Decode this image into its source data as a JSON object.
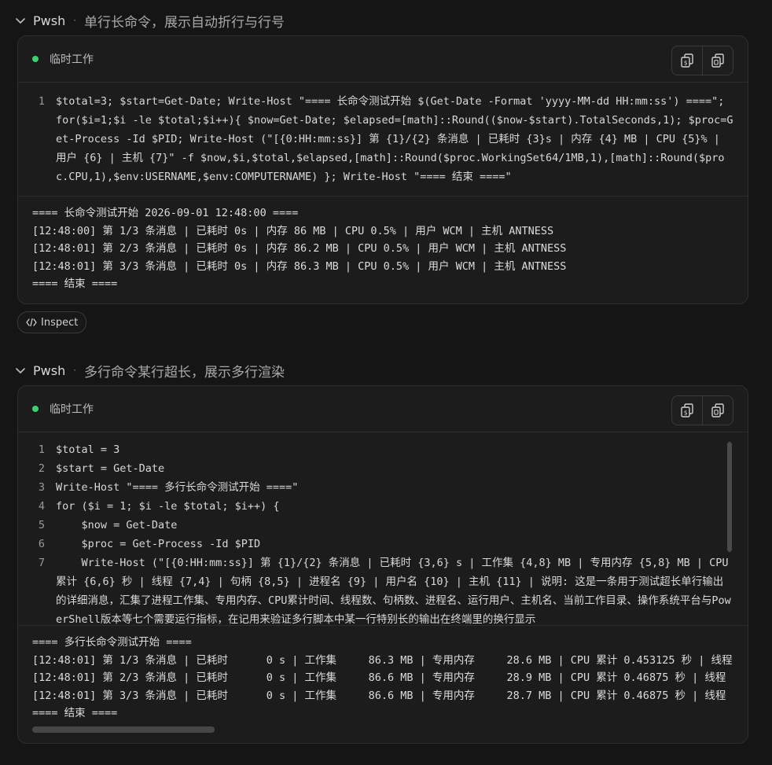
{
  "section1": {
    "tool": "Pwsh",
    "separator": "·",
    "title": "单行长命令，展示自动折行与行号",
    "card_label": "临时工作",
    "code_lines": [
      {
        "num": "1",
        "text": "$total=3; $start=Get-Date; Write-Host \"==== 长命令测试开始 $(Get-Date -Format 'yyyy-MM-dd HH:mm:ss') ====\"; for($i=1;$i -le $total;$i++){ $now=Get-Date; $elapsed=[math]::Round(($now-$start).TotalSeconds,1); $proc=Get-Process -Id $PID; Write-Host (\"[{0:HH:mm:ss}] 第 {1}/{2} 条消息 | 已耗时 {3}s | 内存 {4} MB | CPU {5}% | 用户 {6} | 主机 {7}\" -f $now,$i,$total,$elapsed,[math]::Round($proc.WorkingSet64/1MB,1),[math]::Round($proc.CPU,1),$env:USERNAME,$env:COMPUTERNAME) }; Write-Host \"==== 结束 ====\""
      }
    ],
    "output_lines": [
      "==== 长命令测试开始 2026-09-01 12:48:00 ====",
      "[12:48:00] 第 1/3 条消息 | 已耗时 0s | 内存 86 MB | CPU 0.5% | 用户 WCM | 主机 ANTNESS",
      "[12:48:01] 第 2/3 条消息 | 已耗时 0s | 内存 86.2 MB | CPU 0.5% | 用户 WCM | 主机 ANTNESS",
      "[12:48:01] 第 3/3 条消息 | 已耗时 0s | 内存 86.3 MB | CPU 0.5% | 用户 WCM | 主机 ANTNESS",
      "==== 结束 ===="
    ]
  },
  "inspect_label": "Inspect",
  "section2": {
    "tool": "Pwsh",
    "separator": "·",
    "title": "多行命令某行超长，展示多行渲染",
    "card_label": "临时工作",
    "code_lines": [
      {
        "num": "1",
        "text": "$total = 3"
      },
      {
        "num": "2",
        "text": "$start = Get-Date"
      },
      {
        "num": "3",
        "text": "Write-Host \"==== 多行长命令测试开始 ====\""
      },
      {
        "num": "4",
        "text": "for ($i = 1; $i -le $total; $i++) {"
      },
      {
        "num": "5",
        "text": "    $now = Get-Date"
      },
      {
        "num": "6",
        "text": "    $proc = Get-Process -Id $PID"
      },
      {
        "num": "7",
        "text": "    Write-Host (\"[{0:HH:mm:ss}] 第 {1}/{2} 条消息 | 已耗时 {3,6} s | 工作集 {4,8} MB | 专用内存 {5,8} MB | CPU 累计 {6,6} 秒 | 线程 {7,4} | 句柄 {8,5} | 进程名 {9} | 用户名 {10} | 主机 {11} | 说明: 这是一条用于测试超长单行输出的详细消息，汇集了进程工作集、专用内存、CPU累计时间、线程数、句柄数、进程名、运行用户、主机名、当前工作目录、操作系统平台与PowerShell版本等七个需要运行指标，在记用来验证多行脚本中某一行特别长的输出在终端里的换行显示"
      }
    ],
    "output_lines": [
      "==== 多行长命令测试开始 ====",
      "[12:48:01] 第 1/3 条消息 | 已耗时      0 s | 工作集     86.3 MB | 专用内存     28.6 MB | CPU 累计 0.453125 秒 | 线程",
      "[12:48:01] 第 2/3 条消息 | 已耗时      0 s | 工作集     86.6 MB | 专用内存     28.9 MB | CPU 累计 0.46875 秒 | 线程",
      "[12:48:01] 第 3/3 条消息 | 已耗时      0 s | 工作集     86.6 MB | 专用内存     28.7 MB | CPU 累计 0.46875 秒 | 线程",
      "==== 结束 ===="
    ]
  },
  "icons": {
    "chevron": "chevron-down-icon",
    "copy_command": "copy-command-icon",
    "copy_output": "copy-output-icon",
    "inspect": "code-icon"
  },
  "colors": {
    "status_green": "#3ecf6e",
    "background": "#151515",
    "card": "#1c1c1c"
  }
}
